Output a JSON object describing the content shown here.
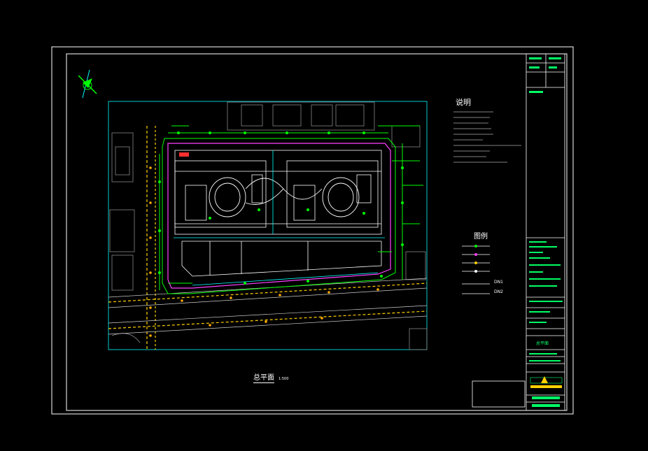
{
  "notes": {
    "title": "说明",
    "lines": [
      "1.  ...",
      "2.  ...",
      "3.  ...",
      "4.  ...",
      "5.  ...",
      "6.  ...",
      "7.  ...",
      "8.  ..."
    ]
  },
  "legend": {
    "title": "图例",
    "items": [
      "",
      "",
      "",
      "",
      "DN1",
      "DN2"
    ]
  },
  "drawing": {
    "caption": "总平面",
    "scale": "1:500"
  },
  "title_block": {
    "stamp_text": "",
    "company_name": "",
    "sheet_title": "总平面",
    "sheet_number": ""
  },
  "colors": {
    "background": "#000000",
    "frame": "#ffffff",
    "site": "#00c8c8",
    "building": "#ffffff",
    "pipe_green": "#00ff00",
    "pipe_magenta": "#ff40ff",
    "road_yellow": "#ffd000",
    "label_green": "#00ff66"
  }
}
